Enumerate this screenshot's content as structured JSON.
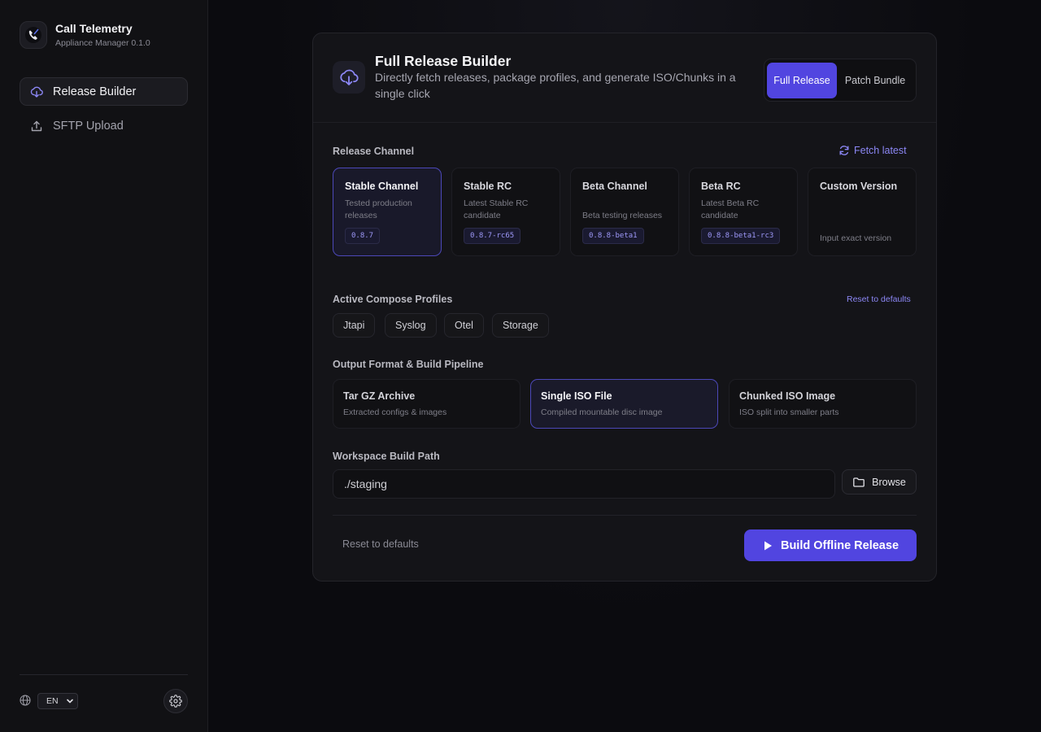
{
  "app": {
    "title": "Call Telemetry",
    "subtitle": "Appliance Manager 0.1.0"
  },
  "sidebar": {
    "items": [
      {
        "label": "Release Builder",
        "icon": "cloud-download-icon",
        "active": true
      },
      {
        "label": "SFTP Upload",
        "icon": "upload-icon",
        "active": false
      }
    ],
    "language": "EN"
  },
  "header": {
    "title": "Full Release Builder",
    "description": "Directly fetch releases, package profiles, and generate ISO/Chunks in a single click",
    "modes": [
      {
        "label": "Full Release",
        "selected": true
      },
      {
        "label": "Patch Bundle",
        "selected": false
      }
    ]
  },
  "channel": {
    "label": "Release Channel",
    "fetch_label": "Fetch latest",
    "options": [
      {
        "name": "Stable Channel",
        "desc": "Tested production releases",
        "version": "0.8.7",
        "selected": true
      },
      {
        "name": "Stable RC",
        "desc": "Latest Stable RC candidate",
        "version": "0.8.7-rc65",
        "selected": false
      },
      {
        "name": "Beta Channel",
        "desc": "Beta testing releases",
        "version": "0.8.8-beta1",
        "selected": false
      },
      {
        "name": "Beta RC",
        "desc": "Latest Beta RC candidate",
        "version": "0.8.8-beta1-rc3",
        "selected": false
      },
      {
        "name": "Custom Version",
        "desc": "Input exact version",
        "version": "",
        "selected": false
      }
    ]
  },
  "profiles": {
    "label": "Active Compose Profiles",
    "reset_label": "Reset to defaults",
    "items": [
      "Jtapi",
      "Syslog",
      "Otel",
      "Storage"
    ]
  },
  "output": {
    "label": "Output Format & Build Pipeline",
    "formats": [
      {
        "name": "Tar GZ Archive",
        "desc": "Extracted configs & images",
        "selected": false
      },
      {
        "name": "Single ISO File",
        "desc": "Compiled mountable disc image",
        "selected": true
      },
      {
        "name": "Chunked ISO Image",
        "desc": "ISO split into smaller parts",
        "selected": false
      }
    ]
  },
  "workspace": {
    "label": "Workspace Build Path",
    "value": "./staging",
    "browse_label": "Browse"
  },
  "footer": {
    "reset_label": "Reset to defaults",
    "build_label": "Build Offline Release"
  },
  "colors": {
    "accent": "#5145e0",
    "accent_text": "#8c87f5",
    "background": "#0b0b0f",
    "card": "#141418"
  }
}
